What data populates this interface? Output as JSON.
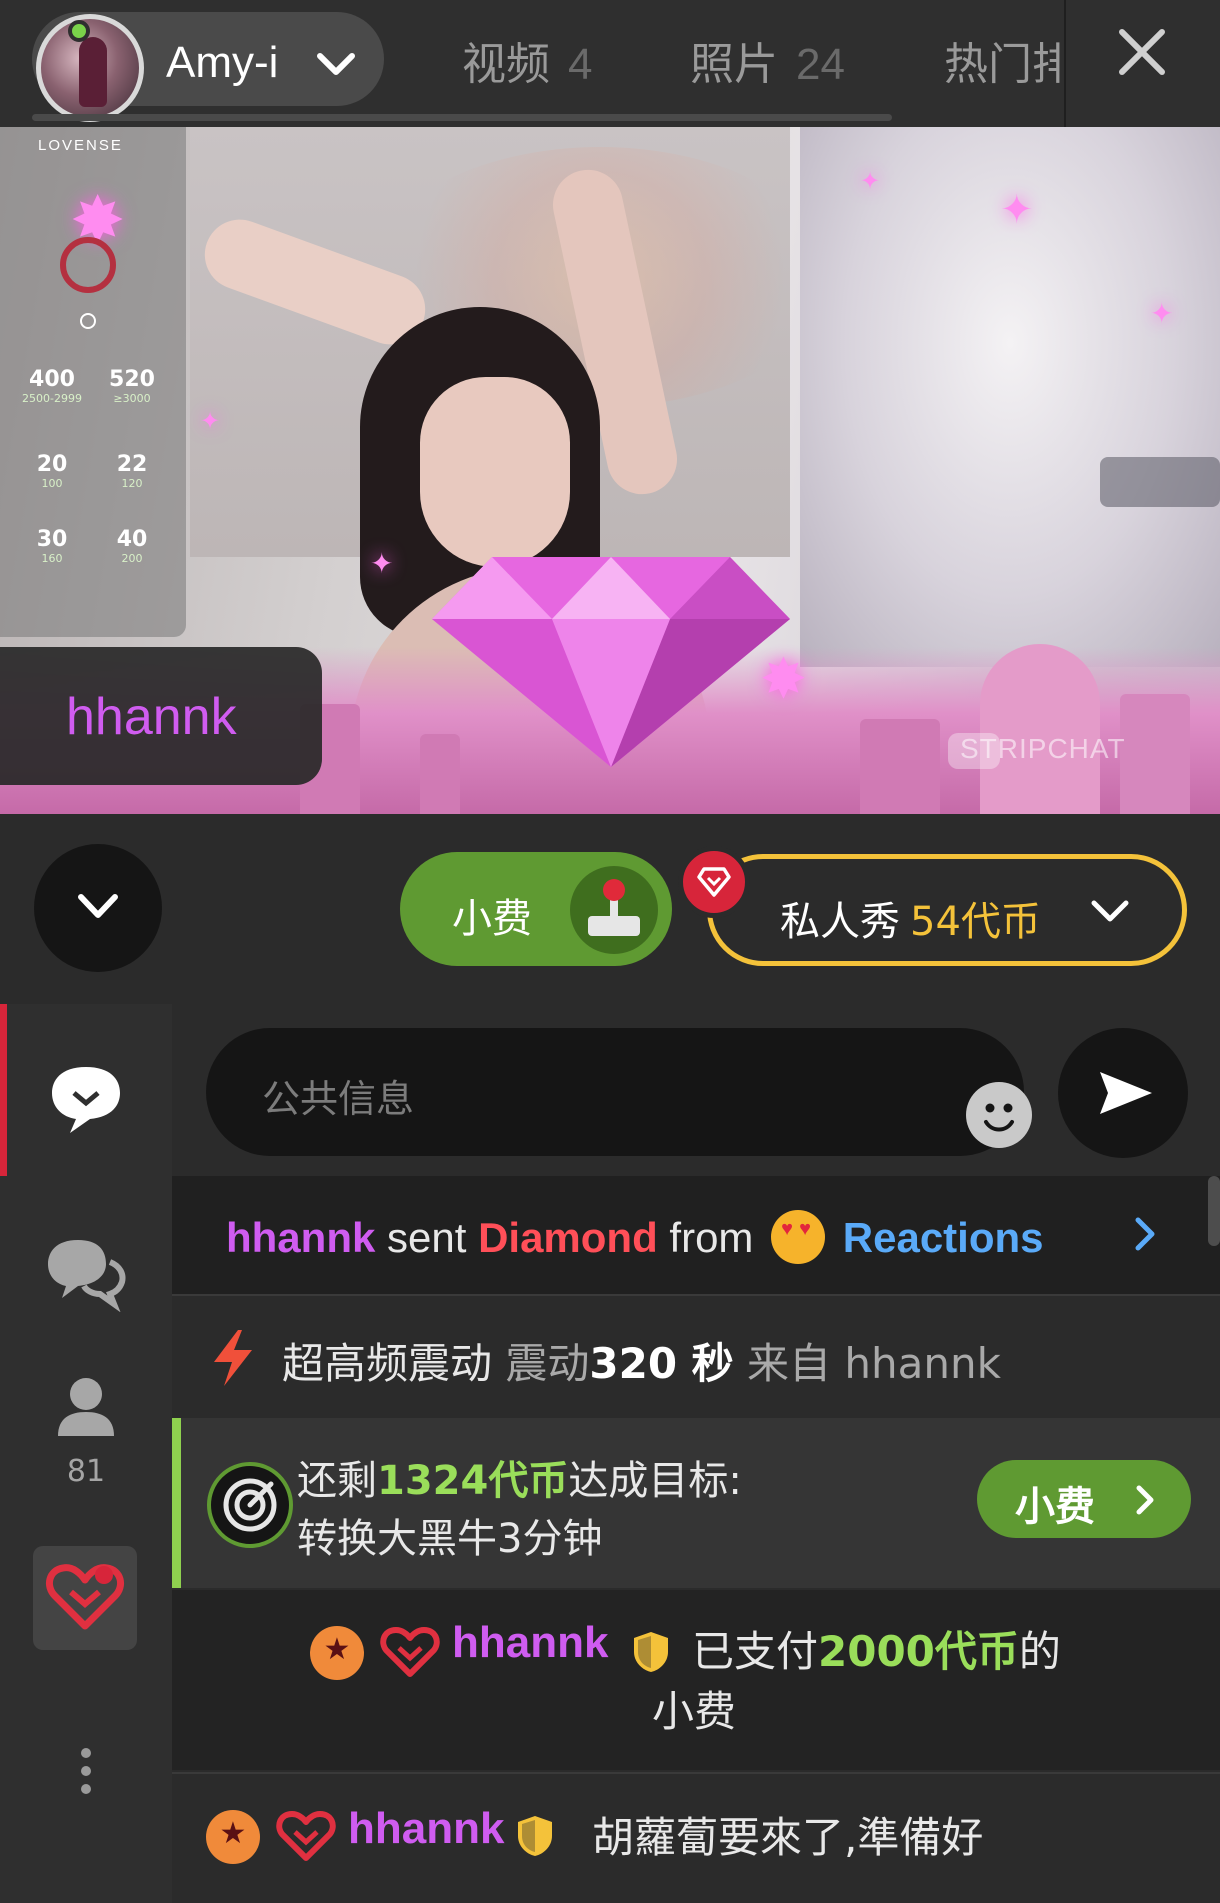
{
  "header": {
    "model_name": "Amy-i",
    "tabs": [
      {
        "label": "视频",
        "count": "4"
      },
      {
        "label": "照片",
        "count": "24"
      },
      {
        "label": "热门排"
      }
    ],
    "close_icon": "close-icon",
    "online_color": "#7ad34a"
  },
  "video": {
    "lovense": {
      "logo": "LOVENSE",
      "levels": [
        {
          "value": "400",
          "range": "2500-2999"
        },
        {
          "value": "520",
          "range": "≥3000"
        },
        {
          "value": "20",
          "range": "100"
        },
        {
          "value": "22",
          "range": "120"
        },
        {
          "value": "30",
          "range": "160"
        },
        {
          "value": "40",
          "range": "200"
        }
      ]
    },
    "gift_sender": "hhannk",
    "watermark": "STRIPCHAT"
  },
  "controls": {
    "tip_label": "小费",
    "private_label": "私人秀",
    "private_price": "54代币",
    "accent_green": "#5f9a32",
    "accent_gold": "#f4c23a",
    "accent_red": "#d7253a"
  },
  "sidebar": {
    "user_count": "81",
    "icons": [
      "public-chat-icon",
      "private-messages-icon",
      "users-icon",
      "favorite-icon",
      "more-icon"
    ]
  },
  "chat": {
    "input_placeholder": "公共信息",
    "messages": {
      "reaction": {
        "user": "hhannk",
        "verb": "sent",
        "gift": "Diamond",
        "from": "from",
        "source": "Reactions"
      },
      "vibration": {
        "mode": "超高频震动",
        "label": "震动",
        "duration": "320 秒",
        "from": "来自",
        "user": "hhannk"
      },
      "goal": {
        "prefix": "还剩",
        "remaining": "1324代币",
        "suffix": "达成目标:",
        "description": "转换大黑牛3分钟",
        "tip_button": "小费"
      },
      "tip": {
        "user": "hhannk",
        "paid_prefix": "已支付",
        "amount": "2000代币",
        "paid_suffix": "的",
        "line2": "小费"
      },
      "chat": {
        "user": "hhannk",
        "text": "胡蘿蔔要來了,準備好"
      }
    }
  }
}
